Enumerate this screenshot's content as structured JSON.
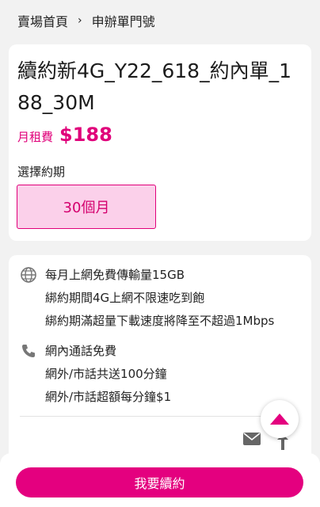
{
  "breadcrumb": {
    "home": "賣場首頁",
    "current": "申辦單門號"
  },
  "plan": {
    "title": "續約新4G_Y22_618_約內單_188_30M",
    "price_label": "月租費",
    "price_value": "$188",
    "period_label": "選擇約期",
    "period_option": "30個月"
  },
  "features": {
    "data": [
      "每月上網免費傳輸量15GB",
      "綁約期間4G上網不限速吃到飽",
      "綁約期滿超量下載速度將降至不超過1Mbps"
    ],
    "voice": [
      "網內通話免費",
      "網外/市話共送100分鐘",
      "網外/市話超額每分鐘$1"
    ]
  },
  "actions": {
    "renew": "我要續約"
  },
  "colors": {
    "accent": "#e4007f",
    "selected_bg": "#fbd0ea",
    "page_bg": "#f2f2f2"
  },
  "icons": {
    "breadcrumb_sep": "chevron-right-icon",
    "data": "globe-icon",
    "voice": "phone-icon",
    "mail": "mail-icon",
    "share": "share-icon",
    "scroll_top": "chevron-up-icon"
  }
}
